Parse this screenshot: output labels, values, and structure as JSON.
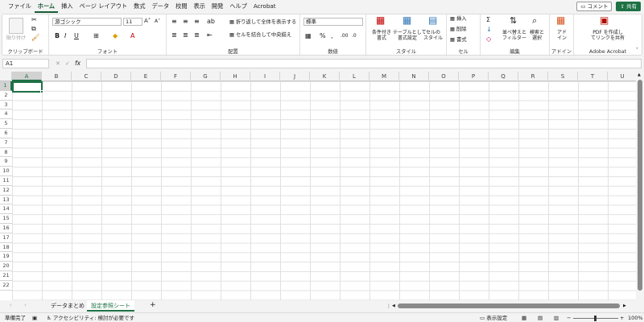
{
  "menu": {
    "tabs": [
      "ファイル",
      "ホーム",
      "挿入",
      "ページ レイアウト",
      "数式",
      "データ",
      "校閲",
      "表示",
      "開発",
      "ヘルプ",
      "Acrobat"
    ],
    "comment_label": "コメント",
    "share_label": "共有"
  },
  "ribbon": {
    "clipboard": {
      "label": "クリップボード",
      "paste_label": "貼り付け"
    },
    "font": {
      "label": "フォント",
      "font_name": "游ゴシック",
      "font_size": "11"
    },
    "alignment": {
      "label": "配置",
      "wrap_text": "折り返して全体を表示する",
      "merge_center": "セルを結合して中央揃え"
    },
    "number": {
      "label": "数値",
      "format": "標準"
    },
    "styles": {
      "label": "スタイル",
      "conditional": "条件付き\n書式",
      "table": "テーブルとして\n書式設定",
      "cell_styles": "セルの\nスタイル"
    },
    "cells": {
      "label": "セル",
      "insert": "挿入",
      "delete": "削除",
      "format": "書式"
    },
    "editing": {
      "label": "編集",
      "sort_filter": "並べ替えと\nフィルター",
      "find_select": "検索と\n選択"
    },
    "addins": {
      "label": "アドイン",
      "addin_btn": "アド\nイン"
    },
    "acrobat": {
      "label": "Adobe Acrobat",
      "pdf_btn": "PDF を作成し\nてリンクを共有"
    }
  },
  "formula_bar": {
    "name_box": "A1",
    "fx": "fx",
    "content": ""
  },
  "grid": {
    "columns": [
      "A",
      "B",
      "C",
      "D",
      "E",
      "F",
      "G",
      "H",
      "I",
      "J",
      "K",
      "L",
      "M",
      "N",
      "O",
      "P",
      "Q",
      "R",
      "S",
      "T",
      "U"
    ],
    "rows": [
      "1",
      "2",
      "3",
      "4",
      "5",
      "6",
      "7",
      "8",
      "9",
      "10",
      "11",
      "12",
      "13",
      "14",
      "15",
      "16",
      "17",
      "18",
      "19",
      "20",
      "21",
      "22"
    ],
    "selected_cell": "A1"
  },
  "sheets": {
    "tabs": [
      "データまとめ",
      "設定参照シート"
    ],
    "active_index": 1,
    "add_label": "+"
  },
  "status": {
    "ready": "準備完了",
    "accessibility": "アクセシビリティ: 検討が必要です",
    "display_settings": "表示設定",
    "zoom": "100%"
  },
  "colors": {
    "accent": "#1e7145",
    "grid_line": "#e1e1e1",
    "background": "#f3f3f3"
  }
}
